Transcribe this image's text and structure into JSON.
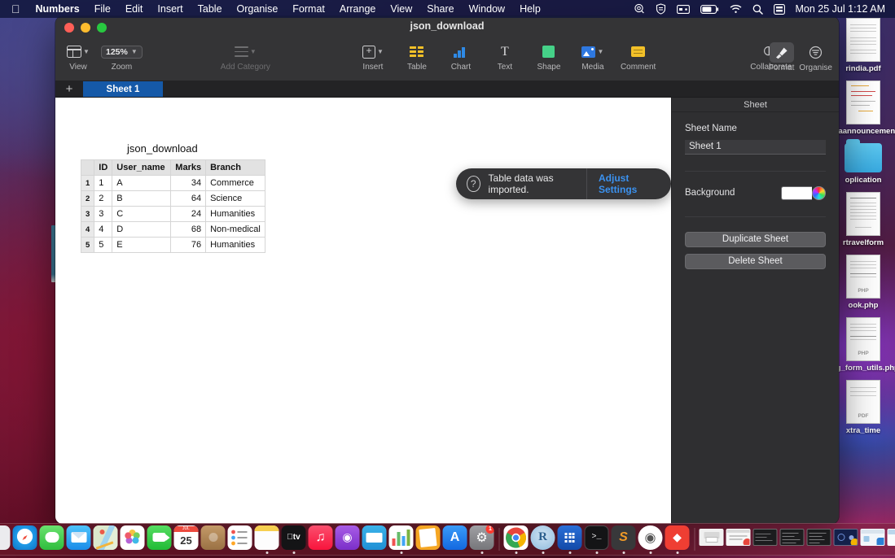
{
  "menubar": {
    "apple_icon": "apple-icon",
    "items": [
      {
        "label": "Numbers",
        "bold": true
      },
      {
        "label": "File",
        "bold": false
      },
      {
        "label": "Edit",
        "bold": false
      },
      {
        "label": "Insert",
        "bold": false
      },
      {
        "label": "Table",
        "bold": false
      },
      {
        "label": "Organise",
        "bold": false
      },
      {
        "label": "Format",
        "bold": false
      },
      {
        "label": "Arrange",
        "bold": false
      },
      {
        "label": "View",
        "bold": false
      },
      {
        "label": "Share",
        "bold": false
      },
      {
        "label": "Window",
        "bold": false
      },
      {
        "label": "Help",
        "bold": false
      }
    ],
    "status_icons": [
      "siri-icon",
      "shield-icon",
      "display-icon",
      "battery-icon",
      "wifi-icon",
      "search-icon",
      "backup-icon"
    ],
    "clock": "Mon 25 Jul  1:12 AM"
  },
  "window": {
    "title": "json_download",
    "traffic_lights": [
      "close-button",
      "minimise-button",
      "zoom-button"
    ]
  },
  "toolbar": {
    "view_label": "View",
    "zoom_label": "Zoom",
    "zoom_value": "125%",
    "add_category_label": "Add Category",
    "insert_label": "Insert",
    "table_label": "Table",
    "chart_label": "Chart",
    "text_label": "Text",
    "shape_label": "Shape",
    "media_label": "Media",
    "comment_label": "Comment",
    "collaborate_label": "Collaborate",
    "format_label": "Format",
    "organise_label": "Organise"
  },
  "sheetbar": {
    "add_label": "+",
    "tabs": [
      {
        "label": "Sheet 1",
        "active": true
      }
    ]
  },
  "canvas": {
    "sheet_title": "json_download"
  },
  "table": {
    "corner": "",
    "columns": [
      "ID",
      "User_name",
      "Marks",
      "Branch"
    ],
    "rows": [
      {
        "n": "1",
        "ID": "1",
        "User_name": "A",
        "Marks": "34",
        "Branch": "Commerce"
      },
      {
        "n": "2",
        "ID": "2",
        "User_name": "B",
        "Marks": "64",
        "Branch": "Science"
      },
      {
        "n": "3",
        "ID": "3",
        "User_name": "C",
        "Marks": "24",
        "Branch": "Humanities"
      },
      {
        "n": "4",
        "ID": "4",
        "User_name": "D",
        "Marks": "68",
        "Branch": "Non-medical"
      },
      {
        "n": "5",
        "ID": "5",
        "User_name": "E",
        "Marks": "76",
        "Branch": "Humanities"
      }
    ]
  },
  "toast": {
    "icon": "question-mark-icon",
    "message": "Table data was imported.",
    "action": "Adjust Settings",
    "action_color": "#3b92f0"
  },
  "inspector": {
    "header": "Sheet",
    "sheet_name_label": "Sheet Name",
    "sheet_name_value": "Sheet 1",
    "background_label": "Background",
    "background_color": "#ffffff",
    "duplicate_label": "Duplicate Sheet",
    "delete_label": "Delete Sheet"
  },
  "desktop_files": [
    {
      "name": "rindia.pdf",
      "kind": "pdf-page"
    },
    {
      "name": "diaannouncement.jpeg",
      "kind": "jpeg-page"
    },
    {
      "name": "oplication",
      "kind": "folder"
    },
    {
      "name": "rtravelform",
      "kind": "doc-page"
    },
    {
      "name": "ook.php",
      "kind": "php-page",
      "badge": "PHP"
    },
    {
      "name": "ng_form_utils.php",
      "kind": "php-page",
      "badge": "PHP"
    },
    {
      "name": "xtra_time",
      "kind": "pdf-page",
      "badge": "PDF"
    }
  ],
  "dock": {
    "items": [
      {
        "name": "finder",
        "running": true,
        "color": "#2b9bf4",
        "glyph": "☺"
      },
      {
        "name": "launchpad",
        "running": false,
        "color": "#e9e9ec",
        "glyph": ""
      },
      {
        "name": "safari",
        "running": false,
        "color": "#f2f2f5",
        "glyph": "🧭"
      },
      {
        "name": "messages",
        "running": false,
        "color": "#4cd55c",
        "glyph": "💬"
      },
      {
        "name": "mail",
        "running": false,
        "color": "#2b9bf4",
        "glyph": "✉"
      },
      {
        "name": "maps",
        "running": false,
        "color": "#e8f3d8",
        "glyph": ""
      },
      {
        "name": "photos",
        "running": false,
        "color": "#ffffff",
        "glyph": "❀"
      },
      {
        "name": "facetime",
        "running": false,
        "color": "#3ec75a",
        "glyph": "📹"
      },
      {
        "name": "calendar",
        "running": false,
        "color": "#ffffff",
        "glyph": "25"
      },
      {
        "name": "contacts",
        "running": false,
        "color": "#b08b5c",
        "glyph": "☻"
      },
      {
        "name": "reminders",
        "running": false,
        "color": "#ffffff",
        "glyph": "☰"
      },
      {
        "name": "notes",
        "running": true,
        "color": "#ffffff",
        "glyph": ""
      },
      {
        "name": "appletv",
        "running": true,
        "color": "#161618",
        "glyph": "tv"
      },
      {
        "name": "music",
        "running": false,
        "color": "#fb2c55",
        "glyph": "♫"
      },
      {
        "name": "podcasts",
        "running": false,
        "color": "#8c46d8",
        "glyph": "◉"
      },
      {
        "name": "keynote",
        "running": false,
        "color": "#1f9fe0",
        "glyph": ""
      },
      {
        "name": "numbers",
        "running": true,
        "color": "#ffffff",
        "glyph": ""
      },
      {
        "name": "pages",
        "running": false,
        "color": "#f2a826",
        "glyph": ""
      },
      {
        "name": "appstore",
        "running": false,
        "color": "#1d7ef5",
        "glyph": "A"
      },
      {
        "name": "settings",
        "running": true,
        "color": "#8d8d90",
        "glyph": "⚙",
        "badge": "1"
      }
    ],
    "items2": [
      {
        "name": "chrome",
        "running": true,
        "color": "#ffffff",
        "glyph": ""
      },
      {
        "name": "rstudio",
        "running": true,
        "color": "#a7cbe8",
        "glyph": "R"
      },
      {
        "name": "drozer",
        "running": true,
        "color": "#1558c0",
        "glyph": "▦"
      },
      {
        "name": "terminal",
        "running": true,
        "color": "#171719",
        "glyph": ">_"
      },
      {
        "name": "sublime",
        "running": true,
        "color": "#3a3a3c",
        "glyph": "S"
      },
      {
        "name": "elephant",
        "running": true,
        "color": "#ffffff",
        "glyph": "🐘"
      },
      {
        "name": "anydesk",
        "running": true,
        "color": "#ef3e33",
        "glyph": "◆"
      }
    ],
    "minimised": [
      {
        "name": "printer-window"
      },
      {
        "name": "chrome-window-1"
      },
      {
        "name": "terminal-window-1"
      },
      {
        "name": "terminal-window-2"
      },
      {
        "name": "terminal-window-3"
      },
      {
        "name": "chrome-window-2"
      },
      {
        "name": "finder-window-1"
      },
      {
        "name": "finder-window-2"
      }
    ],
    "trash": "trash-icon"
  }
}
